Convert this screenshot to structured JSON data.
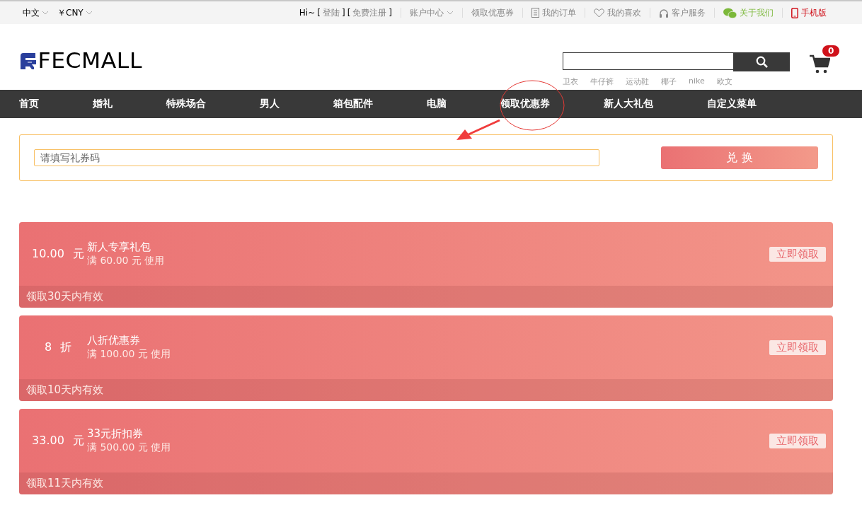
{
  "top_bar": {
    "language": "中文",
    "currency": "￥CNY",
    "greeting": "Hi~",
    "login": {
      "open": "[",
      "label": "登陆",
      "close": "]"
    },
    "register": {
      "open": "[",
      "label": "免费注册",
      "close": "]"
    },
    "links": [
      {
        "label": "账户中心",
        "kind": "dropdown"
      },
      {
        "label": "领取优惠券",
        "kind": "plain"
      },
      {
        "label": "我的订单",
        "kind": "document"
      },
      {
        "label": "我的喜欢",
        "kind": "heart"
      },
      {
        "label": "客户服务",
        "kind": "headset"
      },
      {
        "label": "关于我们",
        "kind": "chat"
      },
      {
        "label": "手机版",
        "kind": "phone"
      }
    ]
  },
  "header": {
    "logo": "FECMALL",
    "hot_words": [
      "卫衣",
      "牛仔裤",
      "运动鞋",
      "椰子",
      "nike",
      "欧文"
    ],
    "cart_count": "0"
  },
  "nav": {
    "items": [
      {
        "label": "首页"
      },
      {
        "label": "婚礼"
      },
      {
        "label": "特殊场合"
      },
      {
        "label": "男人"
      },
      {
        "label": "箱包配件"
      },
      {
        "label": "电脑"
      },
      {
        "label": "领取优惠券"
      },
      {
        "label": "新人大礼包"
      },
      {
        "label": "自定义菜单"
      }
    ]
  },
  "redeem": {
    "placeholder": "请填写礼券码",
    "button": "兑 换"
  },
  "coupons": [
    {
      "amount": "10.00",
      "unit": "元",
      "title": "新人专享礼包",
      "condition": "满 60.00 元 使用",
      "button": "立即领取",
      "validity": "领取30天内有效"
    },
    {
      "amount": "8",
      "unit": "折",
      "title": "八折优惠券",
      "condition": "满 100.00 元 使用",
      "button": "立即领取",
      "validity": "领取10天内有效"
    },
    {
      "amount": "33.00",
      "unit": "元",
      "title": "33元折扣券",
      "condition": "满 500.00 元 使用",
      "button": "立即领取",
      "validity": "领取11天内有效"
    }
  ]
}
